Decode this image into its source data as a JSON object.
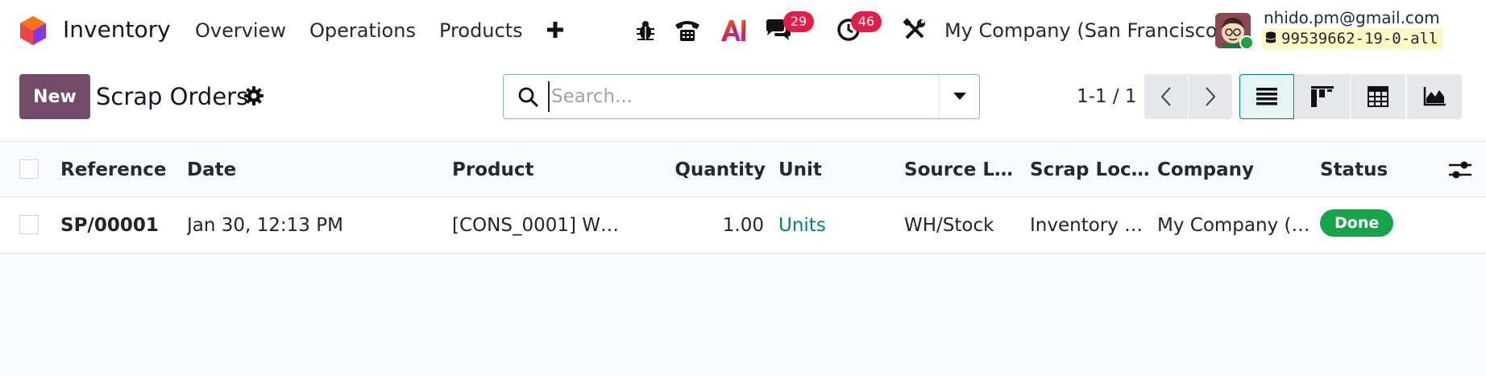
{
  "navbar": {
    "app_name": "Inventory",
    "menu": [
      "Overview",
      "Operations",
      "Products"
    ],
    "plus_label": "+",
    "messages_count": "29",
    "activities_count": "46",
    "company": "My Company (San Francisco)",
    "user_email": "nhido.pm@gmail.com",
    "database": "99539662-19-0-all",
    "ai_label": "AI"
  },
  "control": {
    "new_label": "New",
    "title": "Scrap Orders",
    "search_placeholder": "Search...",
    "pager": "1-1 / 1"
  },
  "table": {
    "columns": [
      "Reference",
      "Date",
      "Product",
      "Quantity",
      "Unit",
      "Source Lo…",
      "Scrap Loc…",
      "Company",
      "Status"
    ],
    "rows": [
      {
        "reference": "SP/00001",
        "date": "Jan 30, 12:13 PM",
        "product": "[CONS_0001] W…",
        "quantity": "1.00",
        "unit": "Units",
        "source_location": "WH/Stock",
        "scrap_location": "Inventory …",
        "company": "My Company (…",
        "status": "Done"
      }
    ]
  },
  "colors": {
    "brand": "#714b67",
    "accent": "#017e84",
    "badge": "#e11d48",
    "done": "#16a34a",
    "link": "#017e84"
  }
}
